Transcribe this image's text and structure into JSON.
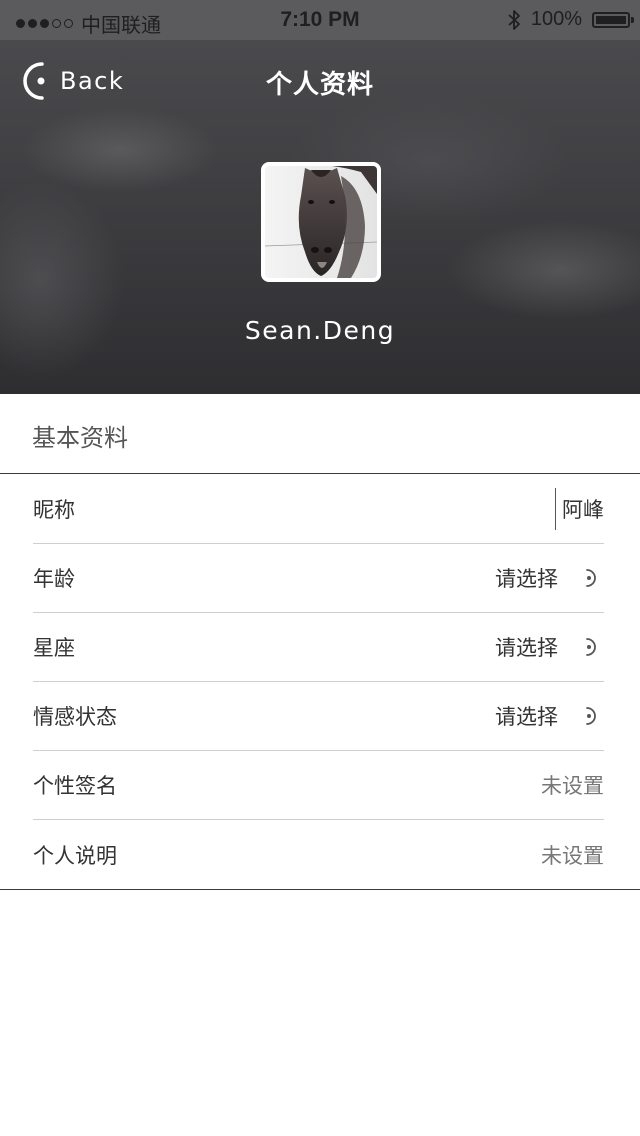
{
  "status_bar": {
    "carrier": "中国联通",
    "time": "7:10 PM",
    "battery": "100%",
    "battery_level": 1.0,
    "signal_strength": 3,
    "signal_max": 5
  },
  "header": {
    "back_label": "Back",
    "title": "个人资料",
    "user_name": "Sean.Deng"
  },
  "section": {
    "title": "基本资料"
  },
  "rows": [
    {
      "label": "昵称",
      "value": "阿峰"
    },
    {
      "label": "年龄",
      "value": "请选择",
      "icon": "chevron-right-icon"
    },
    {
      "label": "星座",
      "value": "请选择",
      "icon": "chevron-right-icon"
    },
    {
      "label": "情感状态",
      "value": "请选择",
      "icon": "chevron-right-icon"
    },
    {
      "label": "个性签名",
      "value": "未设置"
    },
    {
      "label": "个人说明",
      "value": "未设置"
    }
  ],
  "colors": {
    "header_bg": "#3b3b3e",
    "status_bar_bg": "#5b5b5e",
    "divider": "#cfcfcf",
    "text": "#333333",
    "muted_text": "#777777"
  }
}
